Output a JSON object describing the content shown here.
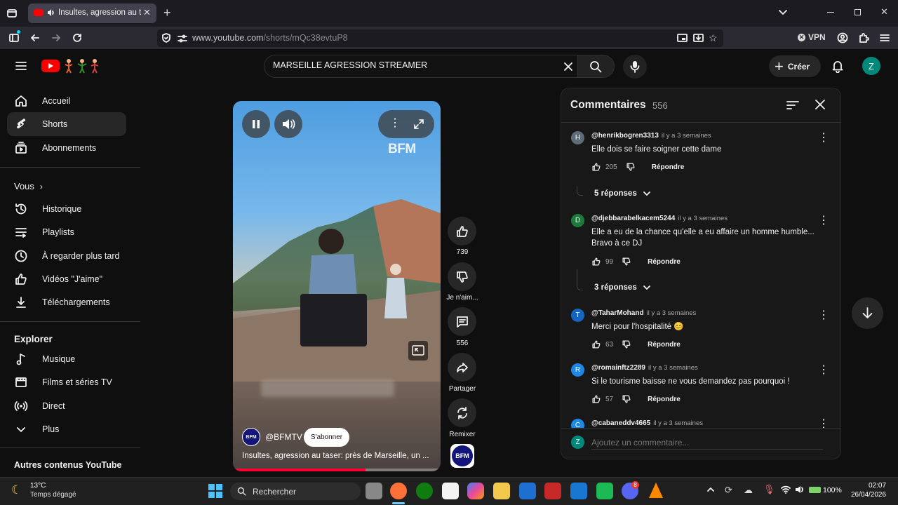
{
  "browser": {
    "tab_title": "Insultes, agression au taser",
    "url_domain": "www.youtube.com",
    "url_path": "/shorts/mQc38evtuP8",
    "vpn_label": "VPN"
  },
  "header": {
    "search_value": "MARSEILLE AGRESSION STREAMER",
    "create_label": "Créer",
    "avatar_letter": "Z"
  },
  "sidebar": {
    "main": [
      {
        "label": "Accueil",
        "icon": "home-icon"
      },
      {
        "label": "Shorts",
        "icon": "shorts-icon"
      },
      {
        "label": "Abonnements",
        "icon": "subscriptions-icon"
      }
    ],
    "you_title": "Vous",
    "you": [
      {
        "label": "Historique",
        "icon": "history-icon"
      },
      {
        "label": "Playlists",
        "icon": "playlists-icon"
      },
      {
        "label": "À regarder plus tard",
        "icon": "clock-icon"
      },
      {
        "label": "Vidéos \"J'aime\"",
        "icon": "thumb-up-icon"
      },
      {
        "label": "Téléchargements",
        "icon": "download-icon"
      }
    ],
    "explore_title": "Explorer",
    "explore": [
      {
        "label": "Musique",
        "icon": "music-icon"
      },
      {
        "label": "Films et séries TV",
        "icon": "film-icon"
      },
      {
        "label": "Direct",
        "icon": "live-icon"
      },
      {
        "label": "Plus",
        "icon": "chevron-down-icon"
      }
    ],
    "other_title": "Autres contenus YouTube"
  },
  "short": {
    "watermark": "BFM",
    "channel": "@BFMTV",
    "subscribe": "S'abonner",
    "title": "Insultes, agression au taser: près de Marseille, un ...",
    "likes": "739",
    "dislike_label": "Je n'aim...",
    "comments": "556",
    "share_label": "Partager",
    "remix_label": "Remixer",
    "channel_logo": "BFM",
    "progress": 0.64
  },
  "comments_panel": {
    "title": "Commentaires",
    "count": "556",
    "input_placeholder": "Ajoutez un commentaire...",
    "input_avatar": "Z",
    "items": [
      {
        "initial": "H",
        "color": "#5f6b78",
        "user": "@henrikbogren3313",
        "time": "il y a 3 semaines",
        "text": "Elle dois se faire soigner cette dame",
        "likes": "205",
        "reply": "Répondre",
        "replies": "5 réponses"
      },
      {
        "initial": "D",
        "color": "#1e7a3c",
        "user": "@djebbarabelkacem5244",
        "time": "il y a 3 semaines",
        "text": "Elle a eu de la chance qu'elle a eu affaire un homme humble...\nBravo à ce DJ",
        "likes": "99",
        "reply": "Répondre",
        "replies": "3 réponses"
      },
      {
        "initial": "T",
        "color": "#1565c0",
        "user": "@TaharMohand",
        "time": "il y a 3 semaines",
        "text": "Merci pour l'hospitalité 😊",
        "likes": "63",
        "reply": "Répondre"
      },
      {
        "initial": "R",
        "color": "#1e88e5",
        "user": "@romainftz2289",
        "time": "il y a 3 semaines",
        "text": "Si le tourisme baisse ne vous demandez pas pourquoi !",
        "likes": "57",
        "reply": "Répondre"
      },
      {
        "initial": "C",
        "color": "#1e88e5",
        "user": "@cabaneddv4665",
        "time": "il y a 3 semaines"
      }
    ]
  },
  "taskbar": {
    "weather_temp": "13°C",
    "weather_desc": "Temps dégagé",
    "search_label": "Rechercher",
    "battery": "100%",
    "time": "02:07",
    "date": "26/04/2026",
    "discord_badge": "8"
  }
}
